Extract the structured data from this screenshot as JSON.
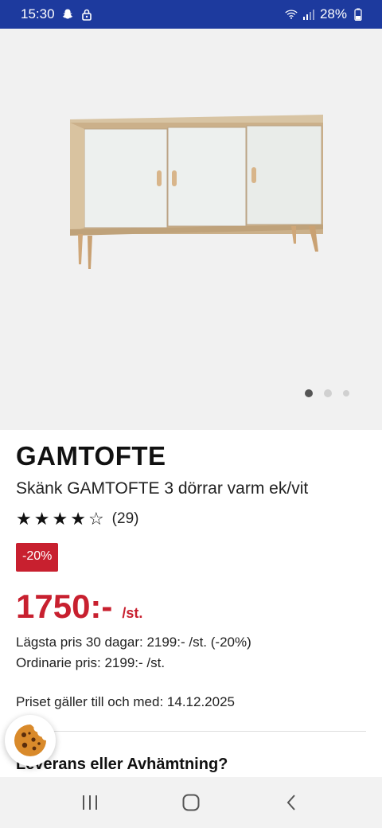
{
  "status_bar": {
    "time": "15:30",
    "battery": "28%"
  },
  "gallery": {
    "image_alt": "Skänk GAMTOFTE 3 dörrar varm ek/vit",
    "dot_count": 3,
    "active_index": 0
  },
  "product": {
    "brand": "GAMTOFTE",
    "name": "Skänk GAMTOFTE 3 dörrar varm ek/vit",
    "rating": 4,
    "rating_max": 5,
    "review_count": "(29)",
    "discount_badge": "-20%",
    "price": "1750:-",
    "unit": "/st.",
    "lowest_price": "Lägsta pris 30 dagar: 2199:- /st. (-20%)",
    "regular_price": "Ordinarie pris: 2199:- /st.",
    "valid_until": "Priset gäller till och med: 14.12.2025"
  },
  "delivery": {
    "heading": "Leverans eller Avhämtning?"
  },
  "colors": {
    "status_bar": "#1d3a9e",
    "sale_red": "#c8202f"
  },
  "nav_bar": {
    "icons": [
      "recent-apps-icon",
      "home-icon",
      "back-icon"
    ]
  }
}
